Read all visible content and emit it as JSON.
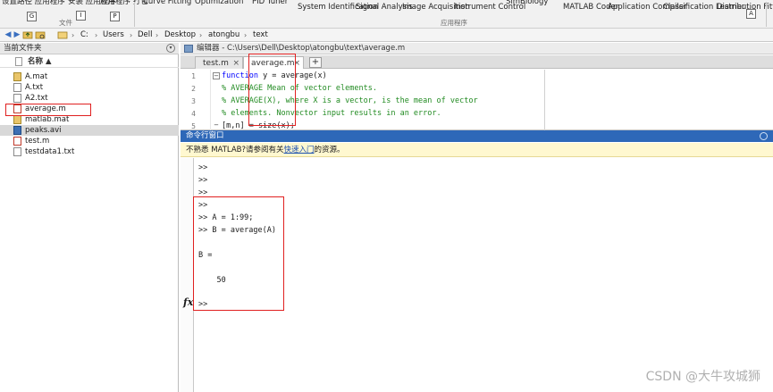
{
  "ribbon": {
    "items": [
      {
        "label": "设置路径 应用程序"
      },
      {
        "label": "安装 应用程序"
      },
      {
        "label": "应用程序 打包"
      },
      {
        "label": "Curve Fitting"
      },
      {
        "label": "Optimization"
      },
      {
        "label": "PID Tuner"
      },
      {
        "label": "System Identification"
      },
      {
        "label": "Signal Analysis"
      },
      {
        "label": "Image Acquisition"
      },
      {
        "label": "Instrument Control"
      },
      {
        "label": "SimBiology"
      },
      {
        "label": "MATLAB Coder"
      },
      {
        "label": "Application Compiler"
      },
      {
        "label": "Classification Learner"
      },
      {
        "label": "Distribution Fitting"
      }
    ],
    "key_badges": [
      "G",
      "I",
      "P",
      "A"
    ],
    "group_file_label": "文件",
    "group_apps_label": "应用程序"
  },
  "addressbar": {
    "crumbs": [
      "C:",
      "Users",
      "Dell",
      "Desktop",
      "atongbu",
      "text"
    ],
    "separator": "›"
  },
  "file_browser": {
    "title": "当前文件夹",
    "column_name": "名称 ▲",
    "files": [
      {
        "name": "A.mat",
        "type": "mat"
      },
      {
        "name": "A.txt",
        "type": "txt"
      },
      {
        "name": "A2.txt",
        "type": "txt"
      },
      {
        "name": "average.m",
        "type": "m"
      },
      {
        "name": "matlab.mat",
        "type": "mat"
      },
      {
        "name": "peaks.avi",
        "type": "avi"
      },
      {
        "name": "test.m",
        "type": "m"
      },
      {
        "name": "testdata1.txt",
        "type": "txt"
      }
    ]
  },
  "editor": {
    "title": "编辑器 - C:\\Users\\Dell\\Desktop\\atongbu\\text\\average.m",
    "tabs": [
      {
        "label": "test.m",
        "close": "×"
      },
      {
        "label": "average.m",
        "close": "×"
      }
    ],
    "add_tab": "+",
    "lines": [
      {
        "n": "1",
        "fold": "−",
        "parts": [
          {
            "t": "function",
            "c": "kw"
          },
          {
            "t": " y = average(x)",
            "c": "plain"
          }
        ]
      },
      {
        "n": "2",
        "fold": "",
        "parts": [
          {
            "t": "% AVERAGE Mean of vector elements.",
            "c": "cmt"
          }
        ]
      },
      {
        "n": "3",
        "fold": "",
        "parts": [
          {
            "t": "% AVERAGE(X), where X is a vector, is the mean of vector",
            "c": "cmt"
          }
        ]
      },
      {
        "n": "4",
        "fold": "",
        "parts": [
          {
            "t": "% elements. Nonvector input results in an error.",
            "c": "cmt"
          }
        ]
      },
      {
        "n": "5",
        "fold": "−",
        "parts": [
          {
            "t": "[m,n] = size(x);",
            "c": "plain"
          }
        ]
      }
    ]
  },
  "command_window": {
    "title": "命令行窗口",
    "info_prefix": "不熟悉 MATLAB?请参阅有关",
    "info_link": "快速入门",
    "info_suffix": "的资源。",
    "lines": [
      ">>",
      ">>",
      ">>",
      ">>",
      ">> A = 1:99;",
      ">> B = average(A)",
      "",
      "B =",
      "",
      "    50",
      "",
      ">>"
    ],
    "fx_label": "fx"
  },
  "watermark": "CSDN @大牛攻城狮",
  "colors": {
    "command_title_bg": "#2e68b8",
    "highlight": "#e02020",
    "info_bar_bg": "#fff8d0"
  }
}
